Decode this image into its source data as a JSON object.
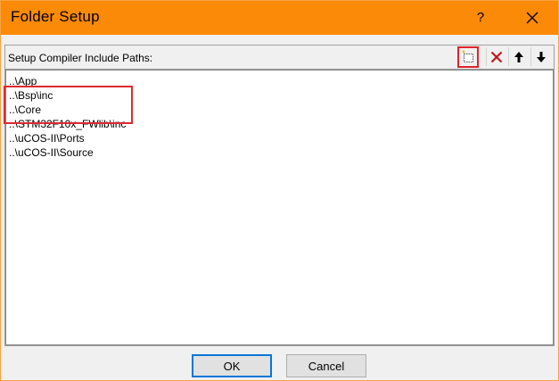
{
  "window": {
    "title": "Folder Setup",
    "help_label": "?"
  },
  "list": {
    "label": "Setup Compiler Include Paths:",
    "items": [
      "..\\App",
      "..\\Bsp\\inc",
      "..\\Core",
      "..\\STM32F10x_FWlib\\inc",
      "..\\uCOS-II\\Ports",
      "..\\uCOS-II\\Source"
    ]
  },
  "toolbar": {
    "icons": [
      "new-folder-icon",
      "delete-icon",
      "move-up-icon",
      "move-down-icon"
    ]
  },
  "buttons": {
    "ok": "OK",
    "cancel": "Cancel"
  },
  "colors": {
    "titlebar": "#fb8a08",
    "highlight": "#dc2a2f",
    "delete": "#c0181e",
    "focus": "#0078d7"
  }
}
